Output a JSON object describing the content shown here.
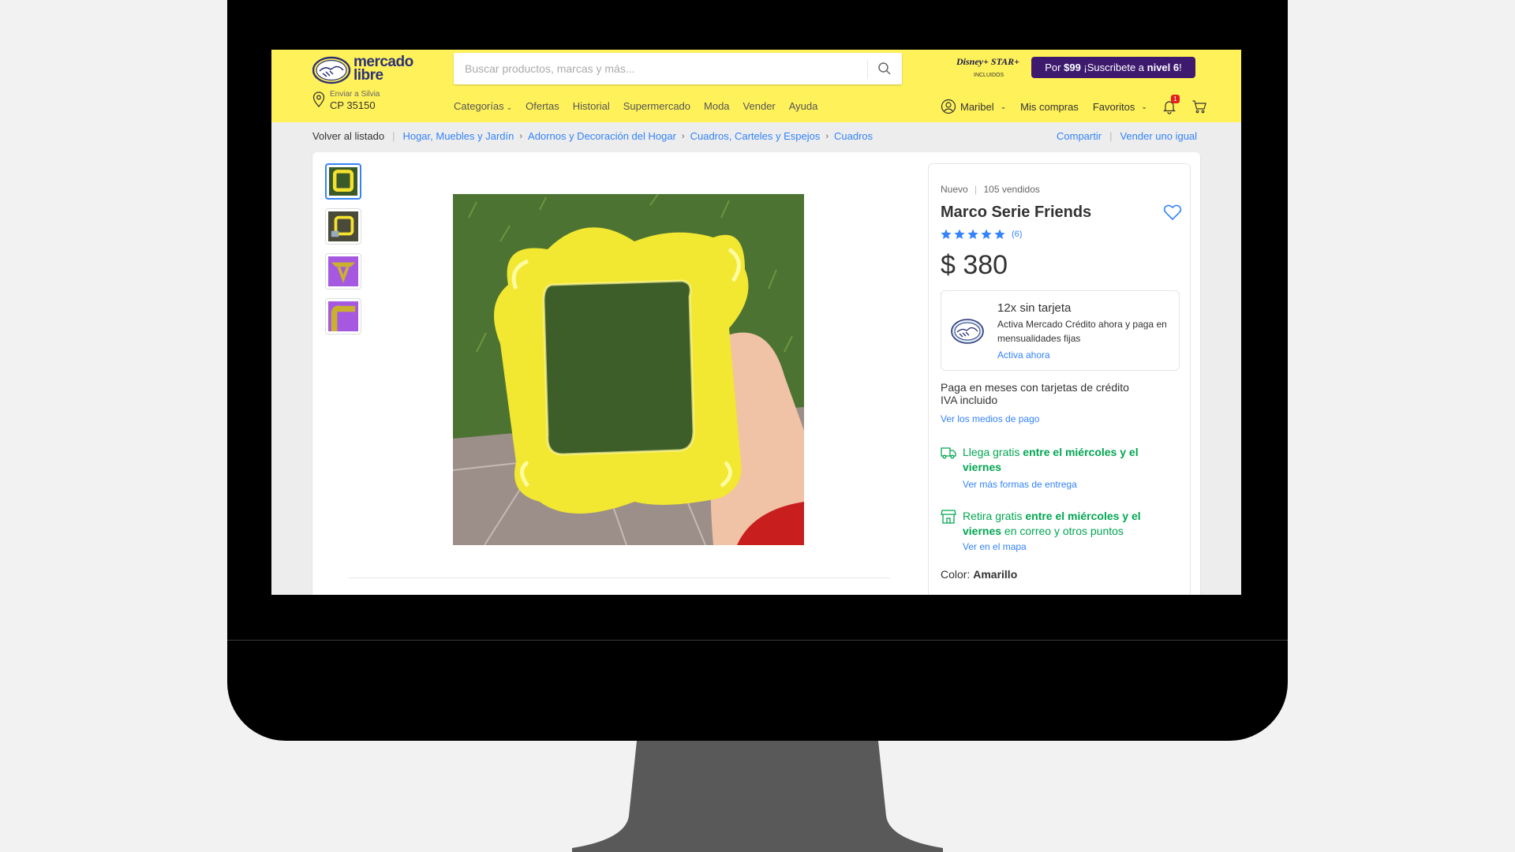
{
  "header": {
    "logo": {
      "line1": "mercado",
      "line2": "libre"
    },
    "search": {
      "placeholder": "Buscar productos, marcas y más..."
    },
    "disney": {
      "brand": "Disney+ STAR+",
      "sub": "INCLUIDOS"
    },
    "promo": {
      "prefix": "Por ",
      "price": "$99",
      "middle": " ¡Suscribete a ",
      "level": "nivel 6",
      "suffix": "!"
    },
    "location": {
      "label": "Enviar a Silvia",
      "value": "CP 35150"
    },
    "nav": [
      "Categorías",
      "Ofertas",
      "Historial",
      "Supermercado",
      "Moda",
      "Vender",
      "Ayuda"
    ],
    "user": {
      "name": "Maribel",
      "purchases": "Mis compras",
      "favorites": "Favoritos",
      "notifications": "1"
    }
  },
  "breadcrumb": {
    "back": "Volver al listado",
    "items": [
      "Hogar, Muebles y Jardín",
      "Adornos y Decoración del Hogar",
      "Cuadros, Carteles y Espejos",
      "Cuadros"
    ],
    "share": "Compartir",
    "sell": "Vender uno igual"
  },
  "product": {
    "condition": "Nuevo",
    "sold": "105 vendidos",
    "title": "Marco Serie Friends",
    "rating": 5,
    "reviews": "(6)",
    "price": "$ 380",
    "credit": {
      "title": "12x sin tarjeta",
      "description": "Activa Mercado Crédito ahora y paga en mensualidades fijas",
      "link": "Activa ahora"
    },
    "installments_line1": "Paga en meses con tarjetas de crédito",
    "installments_line2": "IVA incluido",
    "payment_link": "Ver los medios de pago",
    "shipping": {
      "prefix": "Llega gratis ",
      "highlight": "entre el miércoles y el viernes",
      "link": "Ver más formas de entrega"
    },
    "pickup": {
      "prefix": "Retira gratis ",
      "highlight": "entre el miércoles y el viernes",
      "suffix": " en correo y otros puntos",
      "link": "Ver en el mapa"
    },
    "color_label": "Color: ",
    "color_value": "Amarillo"
  },
  "colors": {
    "header_bg": "#fff159",
    "link": "#3483fa",
    "success": "#00a650",
    "promo_bg": "#3d1a6e"
  }
}
